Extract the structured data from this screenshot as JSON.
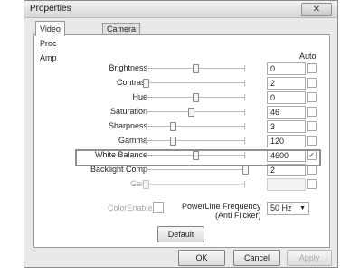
{
  "window": {
    "title": "Properties",
    "close_glyph": "✕"
  },
  "tabs": [
    {
      "label": "Video Proc Amp",
      "active": true
    },
    {
      "label": "Camera Control",
      "active": false
    }
  ],
  "auto_header": "Auto",
  "controls": [
    {
      "label": "Brightness",
      "value": "0",
      "level": 0.5,
      "auto": false,
      "enabled": true
    },
    {
      "label": "Contrast",
      "value": "2",
      "level": 0.0,
      "auto": false,
      "enabled": true
    },
    {
      "label": "Hue",
      "value": "0",
      "level": 0.5,
      "auto": false,
      "enabled": true
    },
    {
      "label": "Saturation",
      "value": "46",
      "level": 0.45,
      "auto": false,
      "enabled": true
    },
    {
      "label": "Sharpness",
      "value": "3",
      "level": 0.27,
      "auto": false,
      "enabled": true
    },
    {
      "label": "Gamma",
      "value": "120",
      "level": 0.27,
      "auto": false,
      "enabled": true
    },
    {
      "label": "White Balance",
      "value": "4600",
      "level": 0.5,
      "auto": true,
      "enabled": true
    },
    {
      "label": "Backlight Comp",
      "value": "2",
      "level": 1.0,
      "auto": false,
      "enabled": true
    },
    {
      "label": "Gain",
      "value": "",
      "level": 0.0,
      "auto": false,
      "enabled": false
    }
  ],
  "color_enable": {
    "label": "ColorEnable",
    "checked": false
  },
  "powerline": {
    "label_line1": "PowerLine Frequency",
    "label_line2": "(Anti Flicker)",
    "value": "50 Hz"
  },
  "buttons": {
    "default": "Default",
    "ok": "OK",
    "cancel": "Cancel",
    "apply": "Apply"
  }
}
